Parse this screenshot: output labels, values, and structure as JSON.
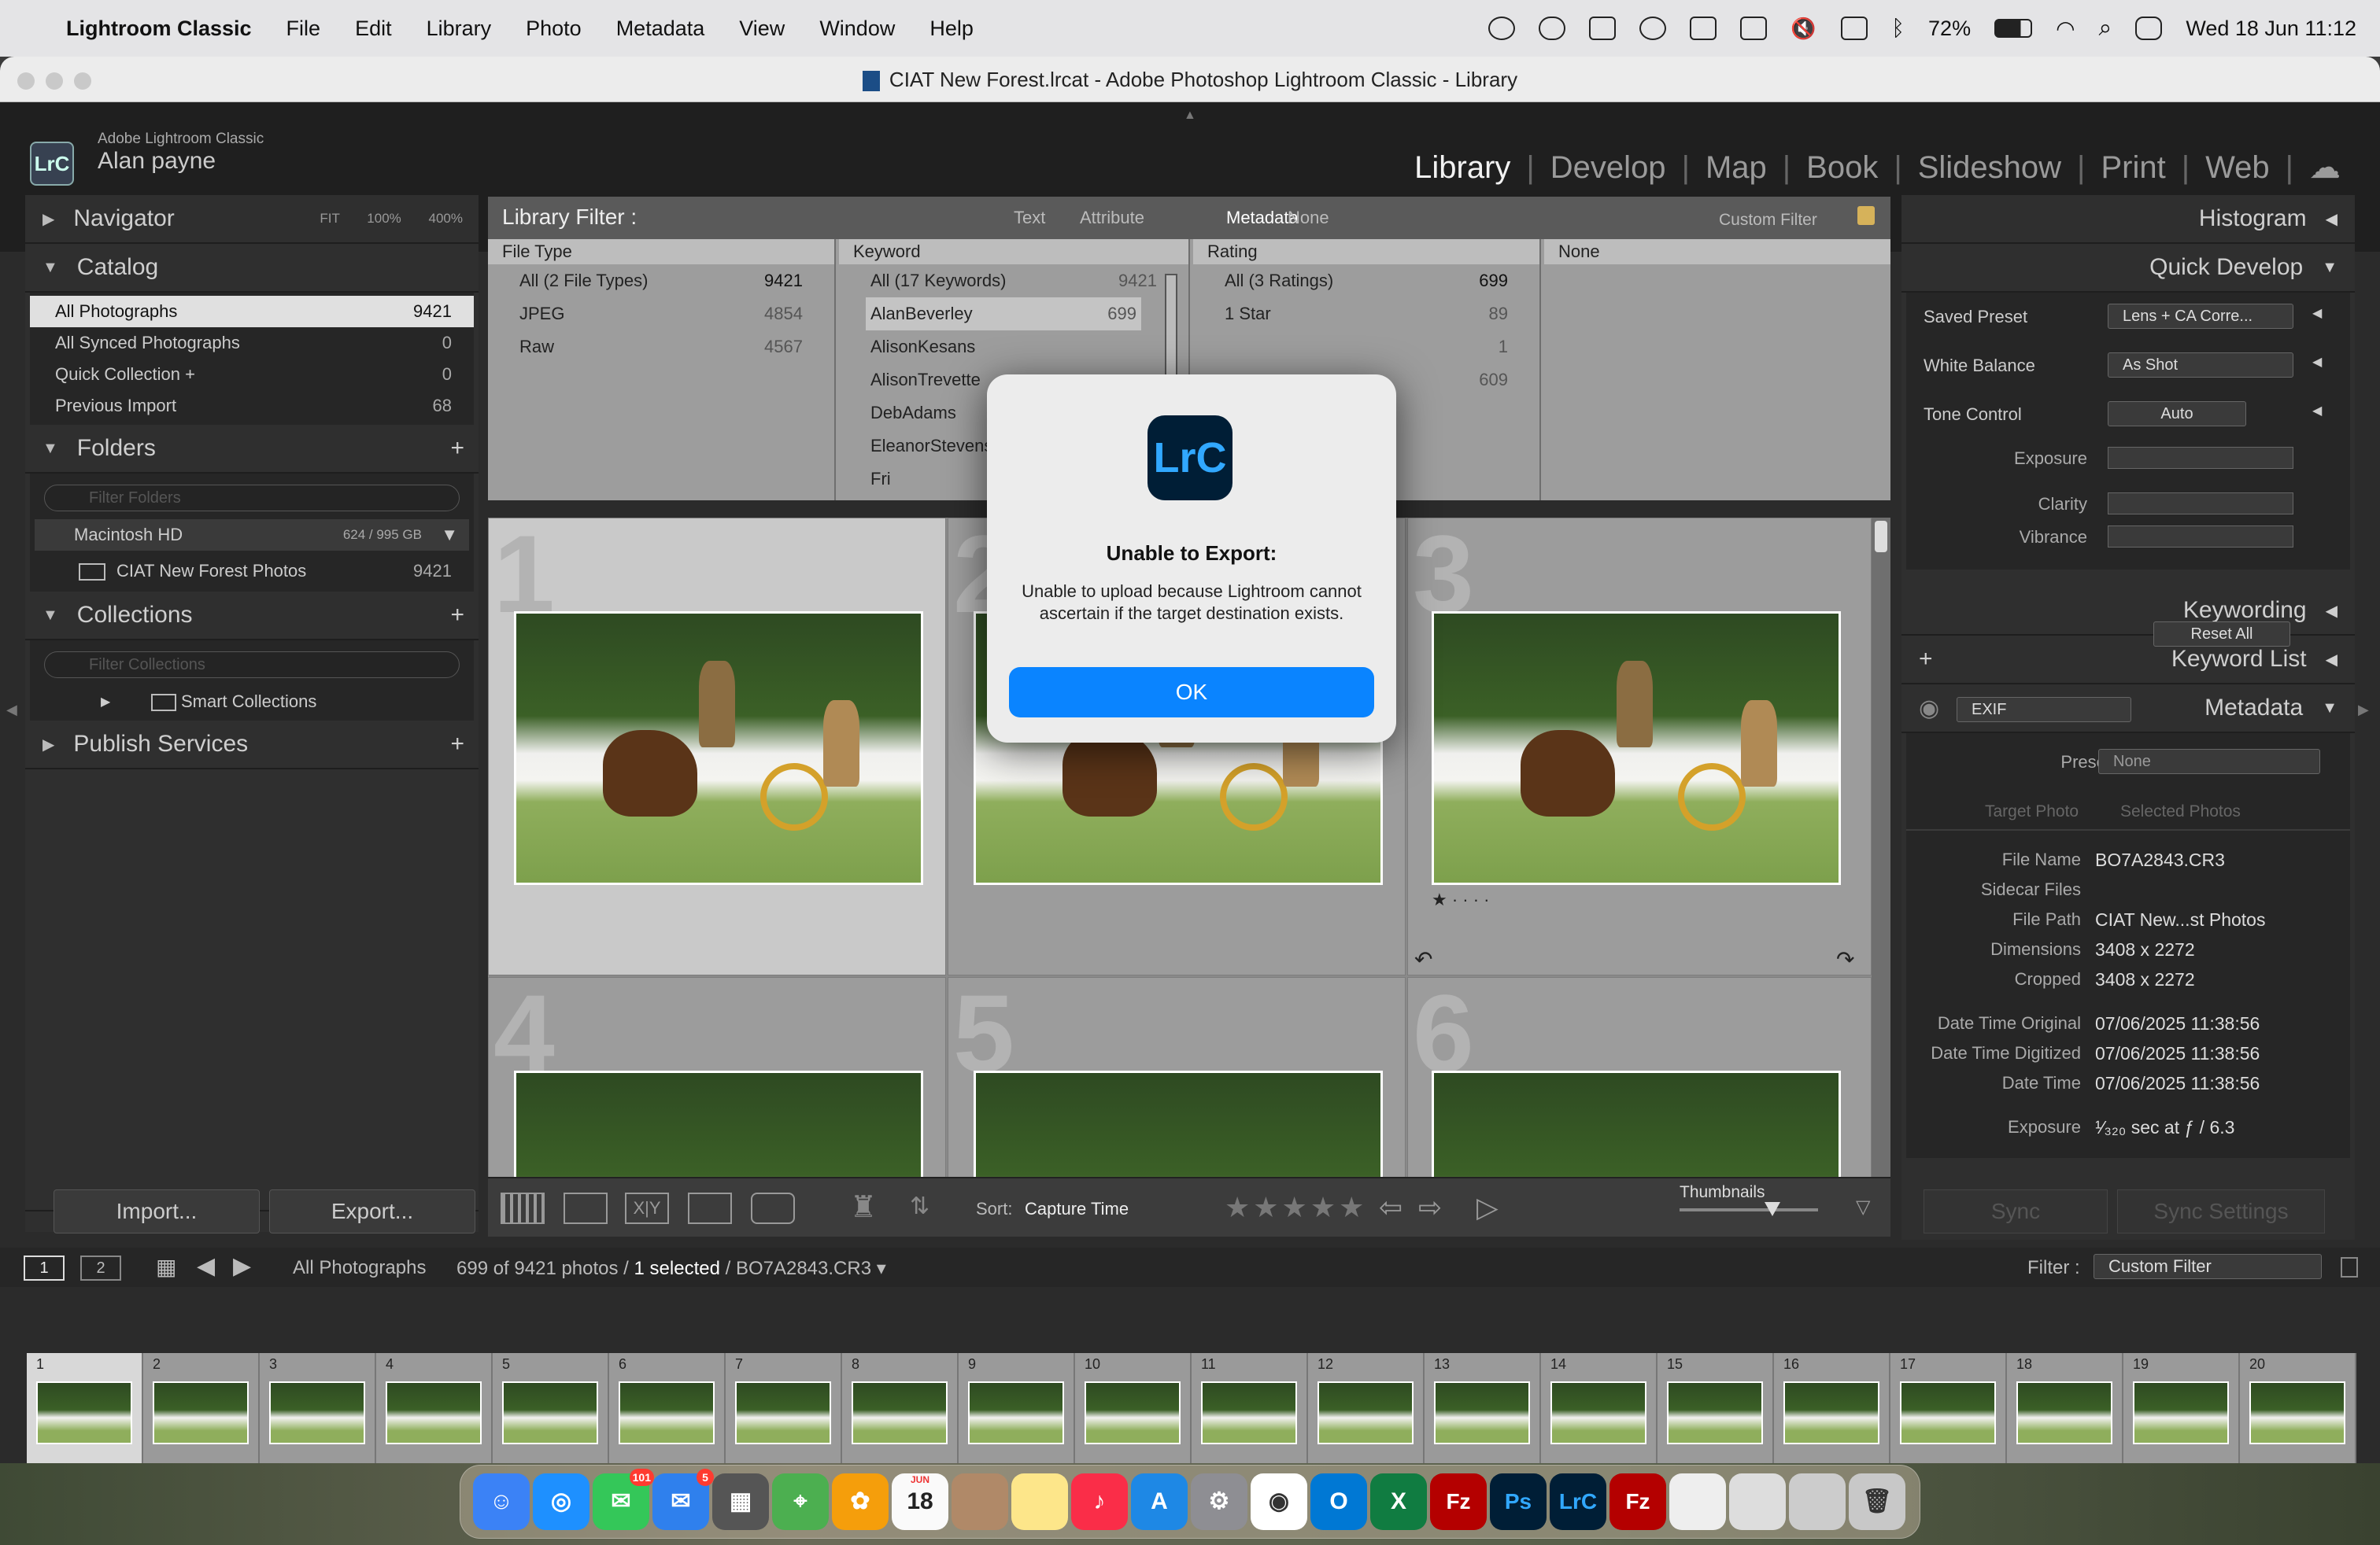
{
  "menubar": {
    "app": "Lightroom Classic",
    "items": [
      "File",
      "Edit",
      "Library",
      "Photo",
      "Metadata",
      "View",
      "Window",
      "Help"
    ],
    "battery": "72%",
    "datetime": "Wed 18 Jun  11:12"
  },
  "window": {
    "title": "CIAT New Forest.lrcat - Adobe Photoshop Lightroom Classic - Library"
  },
  "identity": {
    "product": "Adobe Lightroom Classic",
    "user": "Alan payne",
    "logo": "LrC"
  },
  "modules": [
    "Library",
    "Develop",
    "Map",
    "Book",
    "Slideshow",
    "Print",
    "Web"
  ],
  "left": {
    "navigator": {
      "title": "Navigator",
      "opts": [
        "FIT",
        "100%",
        "400%"
      ]
    },
    "catalog": {
      "title": "Catalog",
      "items": [
        {
          "label": "All Photographs",
          "count": "9421"
        },
        {
          "label": "All Synced Photographs",
          "count": "0"
        },
        {
          "label": "Quick Collection  +",
          "count": "0"
        },
        {
          "label": "Previous Import",
          "count": "68"
        }
      ]
    },
    "folders": {
      "title": "Folders",
      "filter_placeholder": "Filter Folders",
      "volume": "Macintosh HD",
      "volume_size": "624 / 995 GB",
      "folder": "CIAT New Forest Photos",
      "folder_count": "9421"
    },
    "collections": {
      "title": "Collections",
      "filter_placeholder": "Filter Collections",
      "smart": "Smart Collections"
    },
    "publish": {
      "title": "Publish Services"
    },
    "import": "Import...",
    "export": "Export..."
  },
  "filterbar": {
    "title": "Library Filter :",
    "tabs": [
      "Text",
      "Attribute",
      "Metadata",
      "None"
    ],
    "custom": "Custom Filter",
    "cols": [
      {
        "head": "File Type",
        "items": [
          {
            "l": "All (2 File Types)",
            "c": "9421"
          },
          {
            "l": "JPEG",
            "c": "4854"
          },
          {
            "l": "Raw",
            "c": "4567"
          }
        ]
      },
      {
        "head": "Keyword",
        "items": [
          {
            "l": "All (17 Keywords)",
            "c": "9421"
          },
          {
            "l": "AlanBeverley",
            "c": "699"
          },
          {
            "l": "AlisonKesans",
            "c": ""
          },
          {
            "l": "AlisonTrevette",
            "c": ""
          },
          {
            "l": "DebAdams",
            "c": ""
          },
          {
            "l": "EleanorStevens",
            "c": ""
          },
          {
            "l": "Fri",
            "c": ""
          }
        ]
      },
      {
        "head": "Rating",
        "items": [
          {
            "l": "All (3 Ratings)",
            "c": "699"
          },
          {
            "l": "1 Star",
            "c": "89"
          },
          {
            "l": "",
            "c": "1"
          },
          {
            "l": "",
            "c": "609"
          }
        ]
      },
      {
        "head": "None",
        "items": []
      }
    ]
  },
  "grid": {
    "cells": [
      "1",
      "2",
      "3",
      "4",
      "5",
      "6"
    ]
  },
  "toolbar": {
    "sort_label": "Sort:",
    "sort_value": "Capture Time",
    "thumbnails": "Thumbnails"
  },
  "right": {
    "histogram": "Histogram",
    "quick_develop": {
      "title": "Quick Develop",
      "saved_preset": "Saved Preset",
      "saved_preset_val": "Lens + CA Corre...",
      "white_balance": "White Balance",
      "wb_val": "As Shot",
      "tone_control": "Tone Control",
      "auto": "Auto",
      "exposure": "Exposure",
      "clarity": "Clarity",
      "vibrance": "Vibrance",
      "reset": "Reset All"
    },
    "keywording": "Keywording",
    "keyword_list": "Keyword List",
    "metadata": {
      "title": "Metadata",
      "exif": "EXIF",
      "preset_label": "Preset",
      "preset_val": "None",
      "target": "Target Photo",
      "selected": "Selected Photos",
      "fields": [
        {
          "l": "File Name",
          "v": "BO7A2843.CR3"
        },
        {
          "l": "Sidecar Files",
          "v": ""
        },
        {
          "l": "File Path",
          "v": "CIAT New...st Photos"
        },
        {
          "l": "Dimensions",
          "v": "3408 x 2272"
        },
        {
          "l": "Cropped",
          "v": "3408 x 2272"
        },
        {
          "l": "Date Time Original",
          "v": "07/06/2025 11:38:56"
        },
        {
          "l": "Date Time Digitized",
          "v": "07/06/2025 11:38:56"
        },
        {
          "l": "Date Time",
          "v": "07/06/2025 11:38:56"
        },
        {
          "l": "Exposure",
          "v": "¹⁄₃₂₀ sec at ƒ / 6.3"
        }
      ]
    },
    "sync": "Sync",
    "sync_settings": "Sync Settings"
  },
  "filmstrip": {
    "source": "All Photographs",
    "status_a": "699 of 9421 photos /",
    "status_b": "1 selected",
    "status_c": "/ BO7A2843.CR3",
    "filter_label": "Filter :",
    "filter_val": "Custom Filter",
    "pages": [
      "1",
      "2"
    ],
    "frames": [
      "1",
      "2",
      "3",
      "4",
      "5",
      "6",
      "7",
      "8",
      "9",
      "10",
      "11",
      "12",
      "13",
      "14",
      "15",
      "16",
      "17",
      "18",
      "19",
      "20"
    ]
  },
  "dialog": {
    "icon": "LrC",
    "title": "Unable to Export:",
    "message": "Unable to upload because Lightroom cannot ascertain if the target destination exists.",
    "ok": "OK"
  },
  "dock": {
    "badges": {
      "messages": "101",
      "mail": "5"
    },
    "calendar_month": "JUN",
    "calendar_day": "18",
    "apps": [
      "Finder",
      "Safari",
      "Messages",
      "Mail",
      "Calculator",
      "Maps",
      "Photos",
      "Calendar",
      "Contacts",
      "Notes",
      "Music",
      "App Store",
      "System Settings",
      "Chrome",
      "Outlook",
      "Excel",
      "FileZilla",
      "Photoshop",
      "Lightroom Classic",
      "FileZilla",
      "Document",
      "Preview",
      "Screenshot",
      "Trash"
    ]
  }
}
